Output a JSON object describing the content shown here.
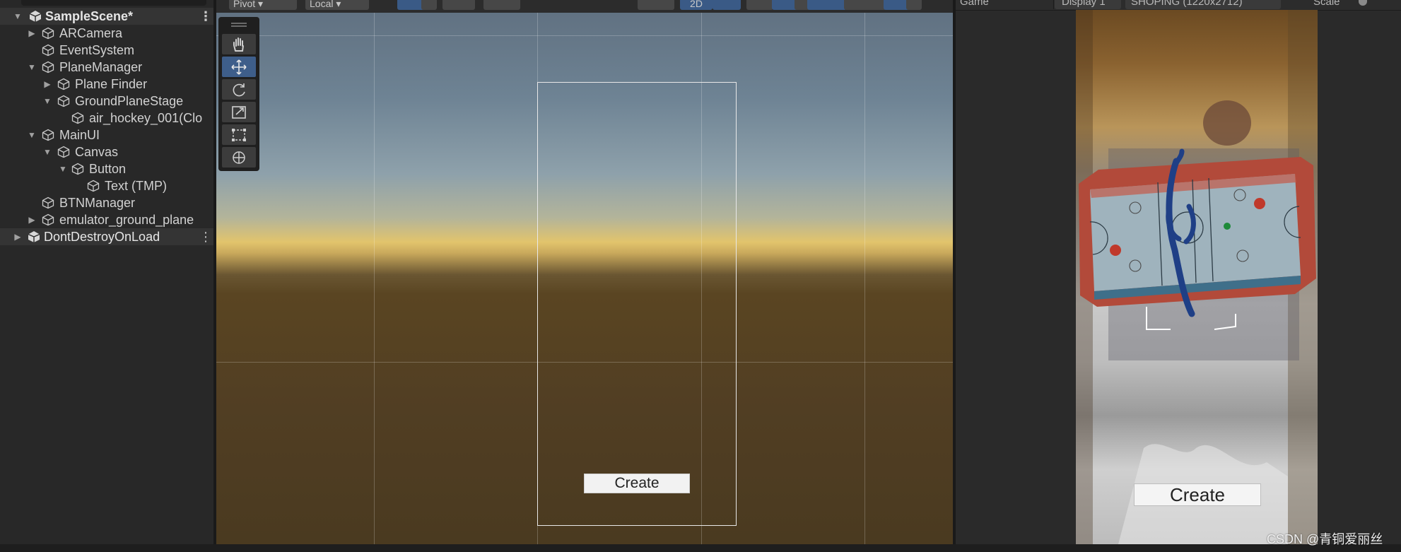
{
  "hierarchy": {
    "scene_name": "SampleScene*",
    "items": [
      {
        "label": "ARCamera"
      },
      {
        "label": "EventSystem"
      },
      {
        "label": "PlaneManager"
      },
      {
        "label": "Plane Finder"
      },
      {
        "label": "GroundPlaneStage"
      },
      {
        "label": "air_hockey_001(Clo"
      },
      {
        "label": "MainUI"
      },
      {
        "label": "Canvas"
      },
      {
        "label": "Button"
      },
      {
        "label": "Text (TMP)"
      },
      {
        "label": "BTNManager"
      },
      {
        "label": "emulator_ground_plane"
      },
      {
        "label": "DontDestroyOnLoad"
      }
    ]
  },
  "scene_toolbar": {
    "pivot_label": "Pivot",
    "local_label": "Local",
    "mode_2d_label": "2D"
  },
  "scene_view": {
    "button_label": "Create"
  },
  "game_toolbar": {
    "tab_label": "Game",
    "display_label": "Display 1",
    "resolution_label": "SHOPING (1220x2712)",
    "scale_label": "Scale"
  },
  "game_view": {
    "button_label": "Create"
  },
  "watermark": "CSDN @青铜爱丽丝",
  "colors": {
    "panel_bg": "#282828",
    "active_tool": "#3e5e8a",
    "table_rim": "#b24a3a",
    "table_surface": "#9fb3bd"
  }
}
